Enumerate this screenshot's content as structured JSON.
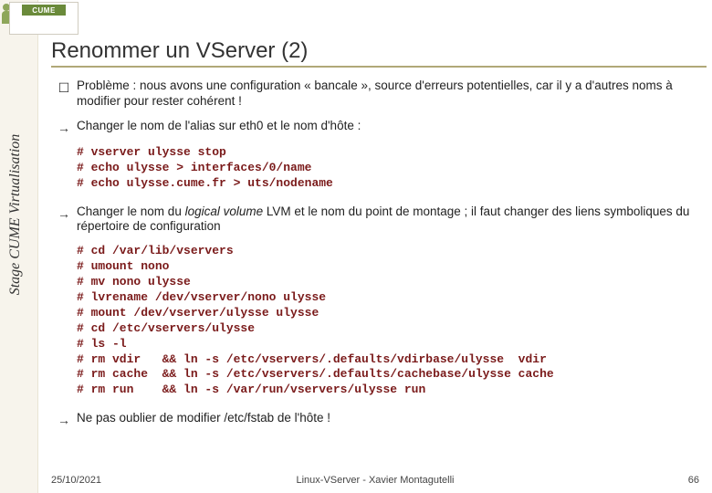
{
  "logo": {
    "text": "CUME"
  },
  "sidebar_label": "Stage CUME Virtualisation",
  "title": "Renommer un VServer (2)",
  "bullets": [
    {
      "marker": "☐",
      "text": "Problème : nous avons une configuration « bancale », source d'erreurs potentielles, car il y a d'autres noms à modifier pour rester cohérent !"
    },
    {
      "marker": "→",
      "text": "Changer le nom de l'alias sur eth0 et le nom d'hôte :"
    }
  ],
  "code1": [
    "# vserver ulysse stop",
    "# echo ulysse > interfaces/0/name",
    "# echo ulysse.cume.fr > uts/nodename"
  ],
  "bullet3": {
    "marker": "→",
    "pre": "Changer le nom du ",
    "ital": "logical volume",
    "post": " LVM et le nom du point de montage ; il faut changer des liens symboliques du répertoire de configuration"
  },
  "code2": [
    "# cd /var/lib/vservers",
    "# umount nono",
    "# mv nono ulysse",
    "# lvrename /dev/vserver/nono ulysse",
    "# mount /dev/vserver/ulysse ulysse",
    "# cd /etc/vservers/ulysse",
    "# ls -l",
    "# rm vdir   && ln -s /etc/vservers/.defaults/vdirbase/ulysse  vdir",
    "# rm cache  && ln -s /etc/vservers/.defaults/cachebase/ulysse cache",
    "# rm run    && ln -s /var/run/vservers/ulysse run"
  ],
  "bullet4": {
    "marker": "→",
    "text": "Ne pas oublier de modifier /etc/fstab de l'hôte !"
  },
  "footer": {
    "left": "25/10/2021",
    "center": "Linux-VServer - Xavier Montagutelli",
    "right": "66"
  }
}
